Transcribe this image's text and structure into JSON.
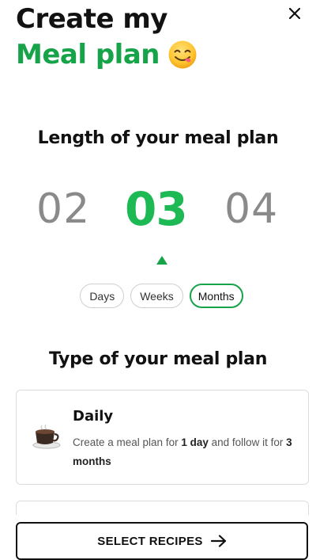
{
  "header": {
    "title_line1": "Create my",
    "title_line2": "Meal plan",
    "emoji_icon": "face-savoring-food-emoji",
    "accent_color": "#17a34a"
  },
  "length_section": {
    "title": "Length of your meal plan",
    "numbers": {
      "previous": "02",
      "current": "03",
      "next": "04"
    },
    "units": [
      "Days",
      "Weeks",
      "Months"
    ],
    "selected_unit": "Months"
  },
  "type_section": {
    "title": "Type of your meal plan",
    "cards": [
      {
        "title": "Daily",
        "icon": "coffee-cup-icon",
        "desc_pre": "Create a meal plan for ",
        "desc_bold1": "1 day",
        "desc_mid": " and follow it for ",
        "desc_bold2": "3 months"
      }
    ]
  },
  "footer": {
    "button_label": "SELECT RECIPES",
    "button_icon": "arrow-right-icon"
  },
  "close_icon": "close-icon"
}
